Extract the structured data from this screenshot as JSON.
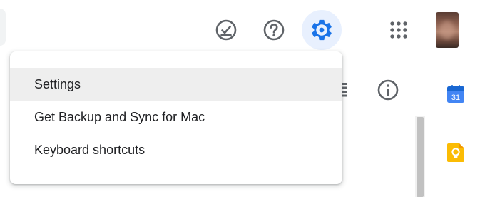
{
  "header": {
    "tasks_icon": "task-done-icon",
    "help_icon": "help-circle-icon",
    "settings_icon": "gear-icon",
    "apps_icon": "apps-grid-icon"
  },
  "toolbar": {
    "list_view_icon": "list-view-icon",
    "info_icon": "info-icon"
  },
  "side_panel": {
    "calendar": {
      "icon": "calendar-icon",
      "date": "31"
    },
    "keep": {
      "icon": "keep-bulb-icon"
    }
  },
  "settings_menu": {
    "items": [
      {
        "label": "Settings",
        "selected": true
      },
      {
        "label": "Get Backup and Sync for Mac",
        "selected": false
      },
      {
        "label": "Keyboard shortcuts",
        "selected": false
      }
    ]
  },
  "colors": {
    "accent": "#1a73e8",
    "active_bg": "#e8f0fe",
    "icon_gray": "#5f6368",
    "calendar_blue": "#4285f4",
    "keep_yellow": "#fbbc04"
  }
}
